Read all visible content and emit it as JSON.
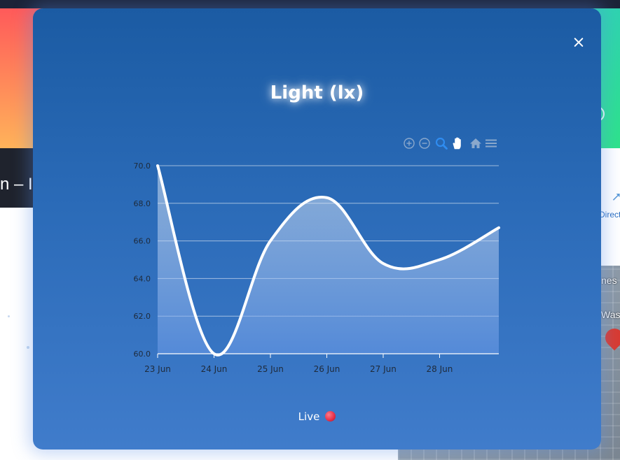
{
  "background": {
    "partial_heading": "n – In",
    "directions_label": "Direct",
    "map_labels": [
      "nes",
      "Was"
    ]
  },
  "modal": {
    "title": "Light (lx)",
    "close_icon": "close-icon",
    "live_label": "Live",
    "live_indicator_color": "#e8324a"
  },
  "toolbar": {
    "icons": [
      "zoom-in-icon",
      "zoom-out-icon",
      "selection-zoom-icon",
      "pan-icon",
      "reset-zoom-home-icon",
      "menu-icon"
    ],
    "active_icon": "selection-zoom-icon"
  },
  "chart_data": {
    "type": "area",
    "title": "Light (lx)",
    "xlabel": "",
    "ylabel": "",
    "x_ticks": [
      "23 Jun",
      "24 Jun",
      "25 Jun",
      "26 Jun",
      "27 Jun",
      "28 Jun"
    ],
    "y_ticks": [
      "60.0",
      "62.0",
      "64.0",
      "66.0",
      "68.0",
      "70.0"
    ],
    "ylim": [
      60,
      70
    ],
    "xlim": [
      0,
      6.05
    ],
    "grid": true,
    "line_color": "#ffffff",
    "series": [
      {
        "x": [
          0,
          1,
          2,
          3,
          4,
          5,
          6.05
        ],
        "values": [
          70.0,
          60.0,
          66.0,
          68.3,
          64.8,
          65.0,
          66.7
        ]
      }
    ]
  }
}
